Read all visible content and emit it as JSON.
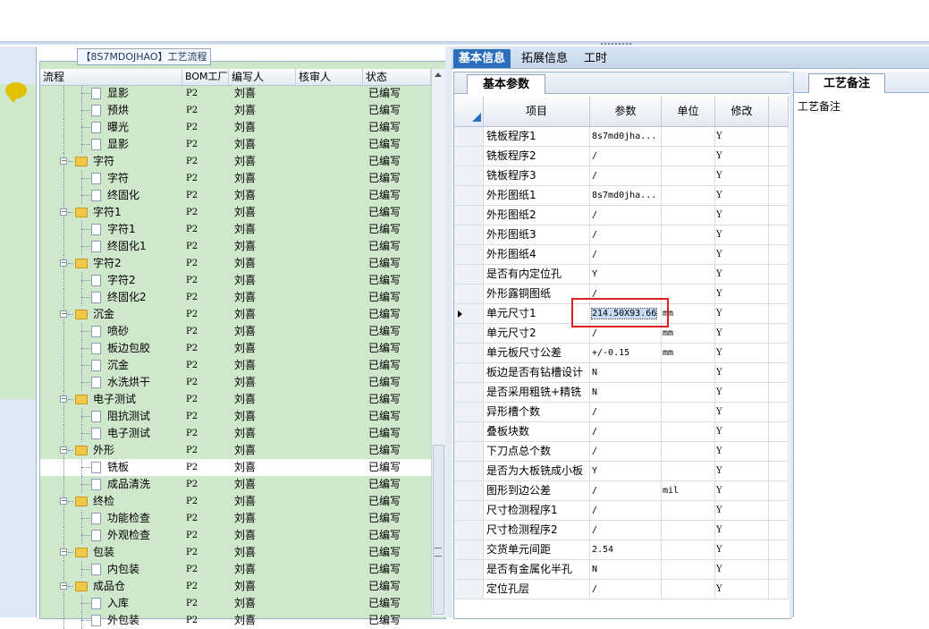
{
  "tree": {
    "title": "【8S7MDOJHAO】工艺流程",
    "columns": [
      "流程",
      "BOM工厂",
      "编写人",
      "核审人",
      "状态"
    ],
    "rows": [
      {
        "level": 2,
        "type": "doc",
        "name": "显影",
        "bom": "P2",
        "writer": "刘喜",
        "status": "已编写"
      },
      {
        "level": 2,
        "type": "doc",
        "name": "预烘",
        "bom": "P2",
        "writer": "刘喜",
        "status": "已编写"
      },
      {
        "level": 2,
        "type": "doc",
        "name": "曝光",
        "bom": "P2",
        "writer": "刘喜",
        "status": "已编写"
      },
      {
        "level": 2,
        "type": "doc",
        "name": "显影",
        "bom": "P2",
        "writer": "刘喜",
        "status": "已编写"
      },
      {
        "level": 1,
        "type": "folder",
        "name": "字符",
        "bom": "P2",
        "writer": "刘喜",
        "status": "已编写"
      },
      {
        "level": 2,
        "type": "doc",
        "name": "字符",
        "bom": "P2",
        "writer": "刘喜",
        "status": "已编写"
      },
      {
        "level": 2,
        "type": "doc",
        "name": "终固化",
        "bom": "P2",
        "writer": "刘喜",
        "status": "已编写"
      },
      {
        "level": 1,
        "type": "folder",
        "name": "字符1",
        "bom": "P2",
        "writer": "刘喜",
        "status": "已编写"
      },
      {
        "level": 2,
        "type": "doc",
        "name": "字符1",
        "bom": "P2",
        "writer": "刘喜",
        "status": "已编写"
      },
      {
        "level": 2,
        "type": "doc",
        "name": "终固化1",
        "bom": "P2",
        "writer": "刘喜",
        "status": "已编写"
      },
      {
        "level": 1,
        "type": "folder",
        "name": "字符2",
        "bom": "P2",
        "writer": "刘喜",
        "status": "已编写"
      },
      {
        "level": 2,
        "type": "doc",
        "name": "字符2",
        "bom": "P2",
        "writer": "刘喜",
        "status": "已编写"
      },
      {
        "level": 2,
        "type": "doc",
        "name": "终固化2",
        "bom": "P2",
        "writer": "刘喜",
        "status": "已编写"
      },
      {
        "level": 1,
        "type": "folder",
        "name": "沉金",
        "bom": "P2",
        "writer": "刘喜",
        "status": "已编写"
      },
      {
        "level": 2,
        "type": "doc",
        "name": "喷砂",
        "bom": "P2",
        "writer": "刘喜",
        "status": "已编写"
      },
      {
        "level": 2,
        "type": "doc",
        "name": "板边包胶",
        "bom": "P2",
        "writer": "刘喜",
        "status": "已编写"
      },
      {
        "level": 2,
        "type": "doc",
        "name": "沉金",
        "bom": "P2",
        "writer": "刘喜",
        "status": "已编写"
      },
      {
        "level": 2,
        "type": "doc",
        "name": "水洗烘干",
        "bom": "P2",
        "writer": "刘喜",
        "status": "已编写"
      },
      {
        "level": 1,
        "type": "folder",
        "name": "电子测试",
        "bom": "P2",
        "writer": "刘喜",
        "status": "已编写"
      },
      {
        "level": 2,
        "type": "doc",
        "name": "阻抗测试",
        "bom": "P2",
        "writer": "刘喜",
        "status": "已编写"
      },
      {
        "level": 2,
        "type": "doc",
        "name": "电子测试",
        "bom": "P2",
        "writer": "刘喜",
        "status": "已编写"
      },
      {
        "level": 1,
        "type": "folder",
        "name": "外形",
        "bom": "P2",
        "writer": "刘喜",
        "status": "已编写"
      },
      {
        "level": 2,
        "type": "doc",
        "name": "铣板",
        "bom": "P2",
        "writer": "刘喜",
        "status": "已编写",
        "selected": true
      },
      {
        "level": 2,
        "type": "doc",
        "name": "成品清洗",
        "bom": "P2",
        "writer": "刘喜",
        "status": "已编写"
      },
      {
        "level": 1,
        "type": "folder",
        "name": "终检",
        "bom": "P2",
        "writer": "刘喜",
        "status": "已编写"
      },
      {
        "level": 2,
        "type": "doc",
        "name": "功能检查",
        "bom": "P2",
        "writer": "刘喜",
        "status": "已编写"
      },
      {
        "level": 2,
        "type": "doc",
        "name": "外观检查",
        "bom": "P2",
        "writer": "刘喜",
        "status": "已编写"
      },
      {
        "level": 1,
        "type": "folder",
        "name": "包装",
        "bom": "P2",
        "writer": "刘喜",
        "status": "已编写"
      },
      {
        "level": 2,
        "type": "doc",
        "name": "内包装",
        "bom": "P2",
        "writer": "刘喜",
        "status": "已编写"
      },
      {
        "level": 1,
        "type": "folder",
        "name": "成品仓",
        "bom": "P2",
        "writer": "刘喜",
        "status": "已编写"
      },
      {
        "level": 2,
        "type": "doc",
        "name": "入库",
        "bom": "P2",
        "writer": "刘喜",
        "status": "已编写"
      },
      {
        "level": 2,
        "type": "doc",
        "name": "外包装",
        "bom": "P2",
        "writer": "刘喜",
        "status": "已编写"
      }
    ]
  },
  "tabs": {
    "basic": "基本信息",
    "extended": "拓展信息",
    "hours": "工时"
  },
  "params": {
    "subtab": "基本参数",
    "columns": {
      "item": "项目",
      "param": "参数",
      "unit": "单位",
      "modify": "修改"
    },
    "rows": [
      {
        "item": "铣板程序1",
        "param": "8s7md0jha...",
        "unit": "",
        "mod": "Y"
      },
      {
        "item": "铣板程序2",
        "param": "/",
        "unit": "",
        "mod": "Y"
      },
      {
        "item": "铣板程序3",
        "param": "/",
        "unit": "",
        "mod": "Y"
      },
      {
        "item": "外形图纸1",
        "param": "8s7md0jha...",
        "unit": "",
        "mod": "Y"
      },
      {
        "item": "外形图纸2",
        "param": "/",
        "unit": "",
        "mod": "Y"
      },
      {
        "item": "外形图纸3",
        "param": "/",
        "unit": "",
        "mod": "Y"
      },
      {
        "item": "外形图纸4",
        "param": "/",
        "unit": "",
        "mod": "Y"
      },
      {
        "item": "是否有内定位孔",
        "param": "Y",
        "unit": "",
        "mod": "Y"
      },
      {
        "item": "外形露铜图纸",
        "param": "/",
        "unit": "",
        "mod": "Y"
      },
      {
        "item": "单元尺寸1",
        "param": "214.50X93.66",
        "unit": "mm",
        "mod": "Y",
        "current": true
      },
      {
        "item": "单元尺寸2",
        "param": "/",
        "unit": "mm",
        "mod": "Y"
      },
      {
        "item": "单元板尺寸公差",
        "param": "+/-0.15",
        "unit": "mm",
        "mod": "Y"
      },
      {
        "item": "板边是否有钻槽设计",
        "param": "N",
        "unit": "",
        "mod": "Y"
      },
      {
        "item": "是否采用粗铣+精铣",
        "param": "N",
        "unit": "",
        "mod": "Y"
      },
      {
        "item": "异形槽个数",
        "param": "/",
        "unit": "",
        "mod": "Y"
      },
      {
        "item": "叠板块数",
        "param": "/",
        "unit": "",
        "mod": "Y"
      },
      {
        "item": "下刀点总个数",
        "param": "/",
        "unit": "",
        "mod": "Y"
      },
      {
        "item": "是否为大板铣成小板",
        "param": "Y",
        "unit": "",
        "mod": "Y"
      },
      {
        "item": "图形到边公差",
        "param": "/",
        "unit": "mil",
        "mod": "Y"
      },
      {
        "item": "尺寸检测程序1",
        "param": "/",
        "unit": "",
        "mod": "Y"
      },
      {
        "item": "尺寸检测程序2",
        "param": "/",
        "unit": "",
        "mod": "Y"
      },
      {
        "item": "交货单元间距",
        "param": "2.54",
        "unit": "",
        "mod": "Y"
      },
      {
        "item": "是否有金属化半孔",
        "param": "N",
        "unit": "",
        "mod": "Y"
      },
      {
        "item": "定位孔层",
        "param": "/",
        "unit": "",
        "mod": "Y"
      }
    ]
  },
  "notes": {
    "tab": "工艺备注",
    "label": "工艺备注"
  },
  "colors": {
    "tab_active": "#2a6ebd",
    "tree_bg": "#cfe8cc",
    "highlight": "#e02020"
  }
}
